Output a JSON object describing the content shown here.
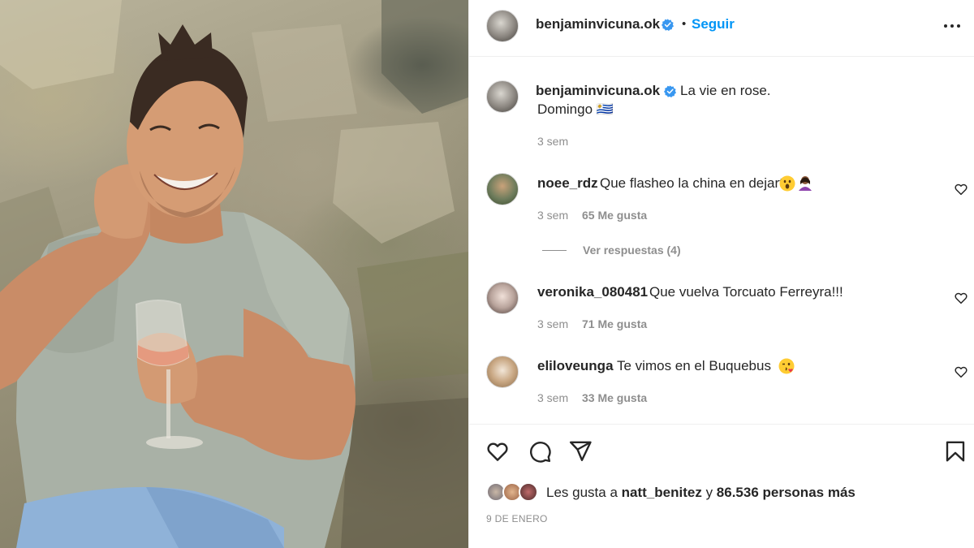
{
  "post": {
    "username": "benjaminvicuna.ok",
    "separator": "•",
    "follow_label": "Seguir",
    "more_icon": "more-options-icon"
  },
  "caption": {
    "username": "benjaminvicuna.ok",
    "line1": "La vie en rose.",
    "line2": "Domingo 🇺🇾",
    "time": "3 sem"
  },
  "comments": [
    {
      "username": "noee_rdz",
      "text": "Que flasheo la china en dejarte",
      "emojis": [
        "astonished-face-emoji",
        "woman-gesturing-emoji"
      ],
      "time": "3 sem",
      "likes": "65 Me gusta",
      "replies_label": "Ver respuestas (4)"
    },
    {
      "username": "veronika_080481",
      "text": "Que vuelva Torcuato Ferreyra!!!",
      "emojis": [],
      "time": "3 sem",
      "likes": "71 Me gusta"
    },
    {
      "username": "eliloveunga",
      "text": "Te vimos en el Buquebus",
      "emojis": [
        "face-blowing-kiss-emoji"
      ],
      "time": "3 sem",
      "likes": "33 Me gusta"
    }
  ],
  "actions": {
    "like_icon": "heart-icon",
    "comment_icon": "comment-icon",
    "share_icon": "share-icon",
    "save_icon": "bookmark-icon"
  },
  "likes": {
    "prefix": "Les gusta a",
    "user": "natt_benitez",
    "connector": "y",
    "others": "86.536 personas más"
  },
  "date": "9 DE ENERO",
  "colors": {
    "accent": "#0095f6",
    "text": "#262626",
    "muted": "#8e8e8e",
    "verified": "#3897f0"
  }
}
